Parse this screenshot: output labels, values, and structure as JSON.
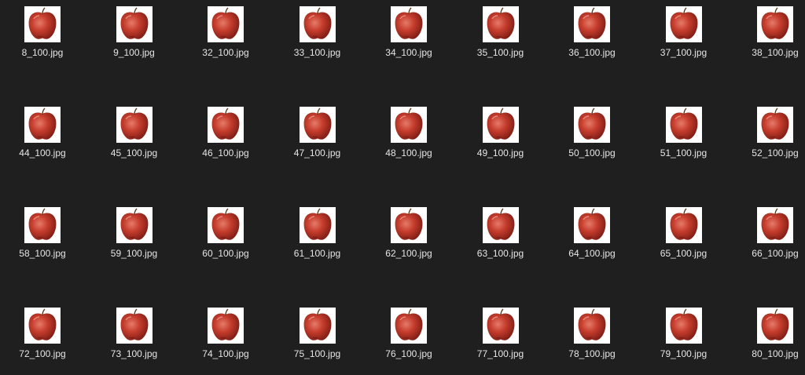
{
  "view": "explorer-large-icons",
  "colors": {
    "background": "#1f1f1f",
    "label": "#e6e6e6",
    "thumb_background": "#ffffff"
  },
  "thumbnail_icon": "apple-thumbnail-icon",
  "rows": [
    [
      "8_100.jpg",
      "9_100.jpg",
      "32_100.jpg",
      "33_100.jpg",
      "34_100.jpg",
      "35_100.jpg",
      "36_100.jpg",
      "37_100.jpg",
      "38_100.jpg"
    ],
    [
      "44_100.jpg",
      "45_100.jpg",
      "46_100.jpg",
      "47_100.jpg",
      "48_100.jpg",
      "49_100.jpg",
      "50_100.jpg",
      "51_100.jpg",
      "52_100.jpg"
    ],
    [
      "58_100.jpg",
      "59_100.jpg",
      "60_100.jpg",
      "61_100.jpg",
      "62_100.jpg",
      "63_100.jpg",
      "64_100.jpg",
      "65_100.jpg",
      "66_100.jpg"
    ],
    [
      "72_100.jpg",
      "73_100.jpg",
      "74_100.jpg",
      "75_100.jpg",
      "76_100.jpg",
      "77_100.jpg",
      "78_100.jpg",
      "79_100.jpg",
      "80_100.jpg"
    ]
  ]
}
